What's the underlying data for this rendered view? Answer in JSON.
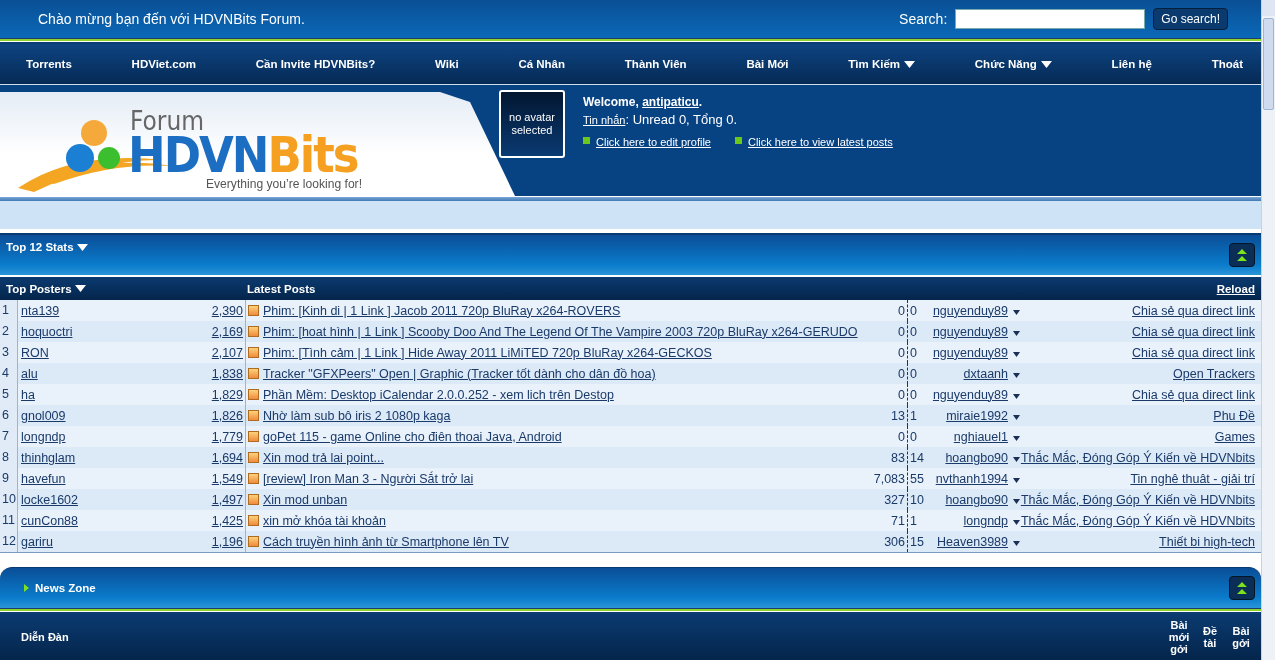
{
  "top_bar": {
    "welcome": "Chào mừng bạn đến với HDVNBits Forum.",
    "search_label": "Search:",
    "search_button": "Go search!"
  },
  "nav": [
    {
      "label": "Torrents",
      "dropdown": false
    },
    {
      "label": "HDViet.com",
      "dropdown": false
    },
    {
      "label": "Cần Invite HDVNBits?",
      "dropdown": false
    },
    {
      "label": "Wiki",
      "dropdown": false
    },
    {
      "label": "Cá Nhân",
      "dropdown": false
    },
    {
      "label": "Thành Viên",
      "dropdown": false
    },
    {
      "label": "Bài Mới",
      "dropdown": false
    },
    {
      "label": "Tìm Kiếm",
      "dropdown": true
    },
    {
      "label": "Chức Năng",
      "dropdown": true
    },
    {
      "label": "Liên hệ",
      "dropdown": false
    },
    {
      "label": "Thoát",
      "dropdown": false
    }
  ],
  "logo": {
    "forum": "Forum",
    "brand_a": "HDVN",
    "brand_b": "Bits",
    "tagline": "Everything you’re looking for!"
  },
  "avatar": {
    "text": "no avatar selected"
  },
  "user_panel": {
    "greeting": "Welcome, ",
    "username": "antipaticu",
    "greeting_end": ".",
    "messages_link": "Tin nhắn",
    "messages_text": ": Unread 0, Tổng 0.",
    "links": [
      "Click here to edit profile",
      "Click here to view latest posts"
    ]
  },
  "stats": {
    "title": "Top 12 Stats",
    "columns": [
      "Top Posters",
      "Latest Posts"
    ],
    "reload": "Reload",
    "posters": [
      {
        "rank": "1",
        "name": "nta139",
        "posts": "2,390"
      },
      {
        "rank": "2",
        "name": "hoquoctri",
        "posts": "2,169"
      },
      {
        "rank": "3",
        "name": "RON",
        "posts": "2,107"
      },
      {
        "rank": "4",
        "name": "alu",
        "posts": "1,838"
      },
      {
        "rank": "5",
        "name": "ha",
        "posts": "1,829"
      },
      {
        "rank": "6",
        "name": "gnol009",
        "posts": "1,826"
      },
      {
        "rank": "7",
        "name": "longndp",
        "posts": "1,779"
      },
      {
        "rank": "8",
        "name": "thinhglam",
        "posts": "1,694"
      },
      {
        "rank": "9",
        "name": "havefun",
        "posts": "1,549"
      },
      {
        "rank": "10",
        "name": "locke1602",
        "posts": "1,497"
      },
      {
        "rank": "11",
        "name": "cunCon88",
        "posts": "1,425"
      },
      {
        "rank": "12",
        "name": "gariru",
        "posts": "1,196"
      }
    ],
    "posts": [
      {
        "title": "Phim: [Kinh di | 1 Link ] Jacob 2011 720p BluRay x264-ROVERS",
        "views": "0",
        "replies": "0",
        "user": "nguyenduy89",
        "forum": "Chia sẻ qua direct link"
      },
      {
        "title": "Phim: [hoat hình | 1 Link ] Scooby Doo And The Legend Of The Vampire 2003 720p BluRay x264-GERUDO",
        "views": "0",
        "replies": "0",
        "user": "nguyenduy89",
        "forum": "Chia sẻ qua direct link"
      },
      {
        "title": "Phim: [Tình cảm | 1 Link ] Hide Away 2011 LiMiTED 720p BluRay x264-GECKOS",
        "views": "0",
        "replies": "0",
        "user": "nguyenduy89",
        "forum": "Chia sẻ qua direct link"
      },
      {
        "title": "Tracker \"GFXPeers\" Open | Graphic (Tracker tốt dành cho dân đồ hoa)",
        "views": "0",
        "replies": "0",
        "user": "dxtaanh",
        "forum": "Open Trackers"
      },
      {
        "title": "Phần Mềm: Desktop iCalendar 2.0.0.252 - xem lich trên Destop",
        "views": "0",
        "replies": "0",
        "user": "nguyenduy89",
        "forum": "Chia sẻ qua direct link"
      },
      {
        "title": "Nhờ làm sub bô iris 2 1080p kaga",
        "views": "13",
        "replies": "1",
        "user": "miraie1992",
        "forum": "Phu Đề"
      },
      {
        "title": "goPet 115 - game Online cho điên thoai Java, Android",
        "views": "0",
        "replies": "0",
        "user": "nghiauel1",
        "forum": "Games"
      },
      {
        "title": "Xin mod trả lai point...",
        "views": "83",
        "replies": "14",
        "user": "hoangbo90",
        "forum": "Thắc Mắc, Đóng Góp Ý Kiến về HDVNbits"
      },
      {
        "title": "[review] Iron Man 3 - Người Sắt trở lai",
        "views": "7,083",
        "replies": "55",
        "user": "nvthanh1994",
        "forum": "Tin nghê thuât - giải trí"
      },
      {
        "title": "Xin mod unban",
        "views": "327",
        "replies": "10",
        "user": "hoangbo90",
        "forum": "Thắc Mắc, Đóng Góp Ý Kiến về HDVNbits"
      },
      {
        "title": "xin mở khóa tài khoản",
        "views": "71",
        "replies": "1",
        "user": "longndp",
        "forum": "Thắc Mắc, Đóng Góp Ý Kiến về HDVNbits"
      },
      {
        "title": "Cách truyền hình ảnh từ Smartphone lên TV",
        "views": "306",
        "replies": "15",
        "user": "Heaven3989",
        "forum": "Thiết bi high-tech"
      }
    ]
  },
  "news": {
    "title": "News Zone",
    "forum_column": "Diễn Đàn",
    "columns": [
      "Bài mới gởi",
      "Đề tài",
      "Bài gởi"
    ]
  }
}
